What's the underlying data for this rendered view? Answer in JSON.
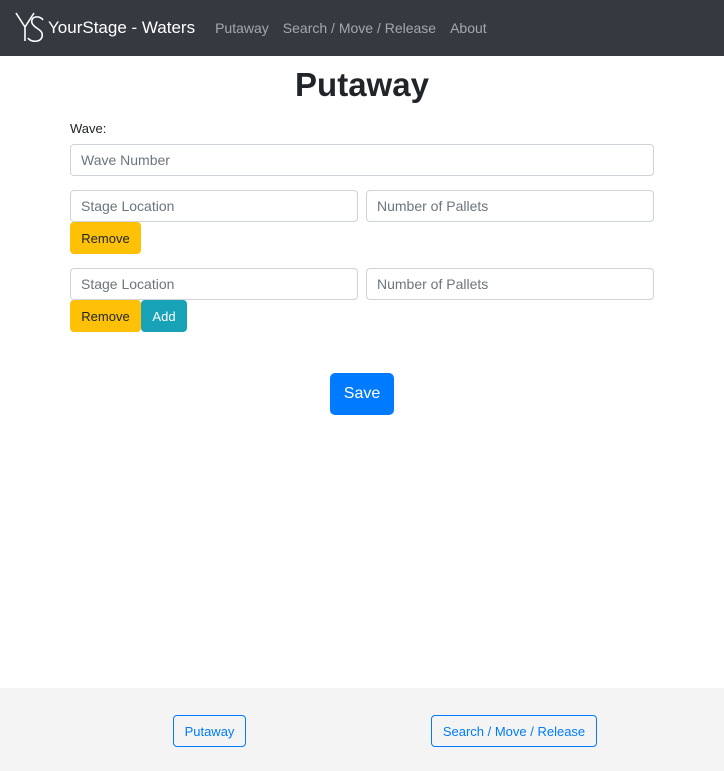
{
  "navbar": {
    "brand_text": "YourStage - Waters",
    "links": [
      "Putaway",
      "Search / Move / Release",
      "About"
    ]
  },
  "main": {
    "title": "Putaway",
    "wave_label": "Wave:",
    "wave_placeholder": "Wave Number",
    "rows": [
      {
        "stage_placeholder": "Stage Location",
        "pallets_placeholder": "Number of Pallets",
        "remove_label": "Remove"
      },
      {
        "stage_placeholder": "Stage Location",
        "pallets_placeholder": "Number of Pallets",
        "remove_label": "Remove",
        "add_label": "Add"
      }
    ],
    "save_label": "Save"
  },
  "footer": {
    "buttons": [
      "Putaway",
      "Search / Move / Release"
    ]
  },
  "colors": {
    "navbar_bg": "#343a40",
    "warning": "#ffc107",
    "info": "#17a2b8",
    "primary": "#007bff",
    "footer_bg": "#f4f4f4"
  }
}
